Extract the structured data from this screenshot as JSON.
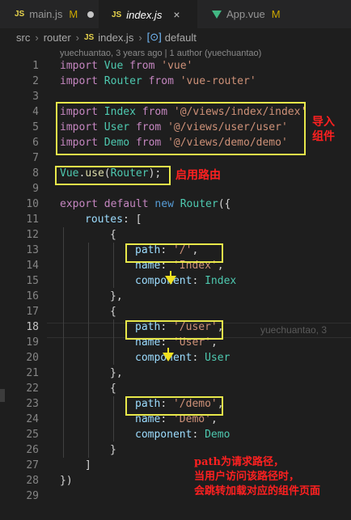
{
  "tabs": [
    {
      "icon": "JS",
      "label": "main.js",
      "status": "M"
    },
    {
      "icon": "JS",
      "label": "index.js",
      "close": "×"
    },
    {
      "icon": "vue",
      "label": "App.vue",
      "status": "M"
    }
  ],
  "breadcrumb": [
    "src",
    "router",
    "index.js",
    "default"
  ],
  "blame_header": "yuechuantao, 3 years ago | 1 author (yuechuantao)",
  "current_line_blame": "yuechuantao, 3",
  "line_numbers": [
    "1",
    "2",
    "3",
    "4",
    "5",
    "6",
    "7",
    "8",
    "9",
    "10",
    "11",
    "12",
    "13",
    "14",
    "15",
    "16",
    "17",
    "18",
    "19",
    "20",
    "21",
    "22",
    "23",
    "24",
    "25",
    "26",
    "27",
    "28",
    "29"
  ],
  "code": {
    "l1": [
      "import",
      " ",
      "Vue",
      " ",
      "from",
      " ",
      "'vue'"
    ],
    "l2": [
      "import",
      " ",
      "Router",
      " ",
      "from",
      " ",
      "'vue-router'"
    ],
    "l4": [
      "import",
      " ",
      "Index",
      " ",
      "from",
      " ",
      "'@/views/index/index'"
    ],
    "l5": [
      "import",
      " ",
      "User",
      " ",
      "from",
      " ",
      "'@/views/user/user'"
    ],
    "l6": [
      "import",
      " ",
      "Demo",
      " ",
      "from",
      " ",
      "'@/views/demo/demo'"
    ],
    "l8": [
      "Vue",
      ".",
      "use",
      "(",
      "Router",
      ");"
    ],
    "l10": [
      "export",
      " ",
      "default",
      " ",
      "new",
      " ",
      "Router",
      "({"
    ],
    "l11": [
      "routes",
      ": ["
    ],
    "l12": "{",
    "l13": [
      "path",
      ": ",
      "'/'",
      ","
    ],
    "l14": [
      "name",
      ": ",
      "'Index'",
      ","
    ],
    "l15": [
      "component",
      ": ",
      "Index"
    ],
    "l16": "},",
    "l17": "{",
    "l18": [
      "path",
      ": ",
      "'/user'",
      ","
    ],
    "l19": [
      "name",
      ": ",
      "'User'",
      ","
    ],
    "l20": [
      "component",
      ": ",
      "User"
    ],
    "l21": "},",
    "l22": "{",
    "l23": [
      "path",
      ": ",
      "'/demo'",
      ","
    ],
    "l24": [
      "name",
      ": ",
      "'Demo'",
      ","
    ],
    "l25": [
      "component",
      ": ",
      "Demo"
    ],
    "l26": "}",
    "l27": "]",
    "l28": "})"
  },
  "annotations": {
    "import_note_1": "导入",
    "import_note_2": "组件",
    "use_note": "启用路由",
    "path_note_1": "path为请求路径，",
    "path_note_2": "当用户访问该路径时，",
    "path_note_3": "会跳转加载对应的组件页面"
  },
  "colors": {
    "highlight_box": "#e8e84a",
    "annotation_text": "#ff2020",
    "arrow": "#f0e020"
  }
}
